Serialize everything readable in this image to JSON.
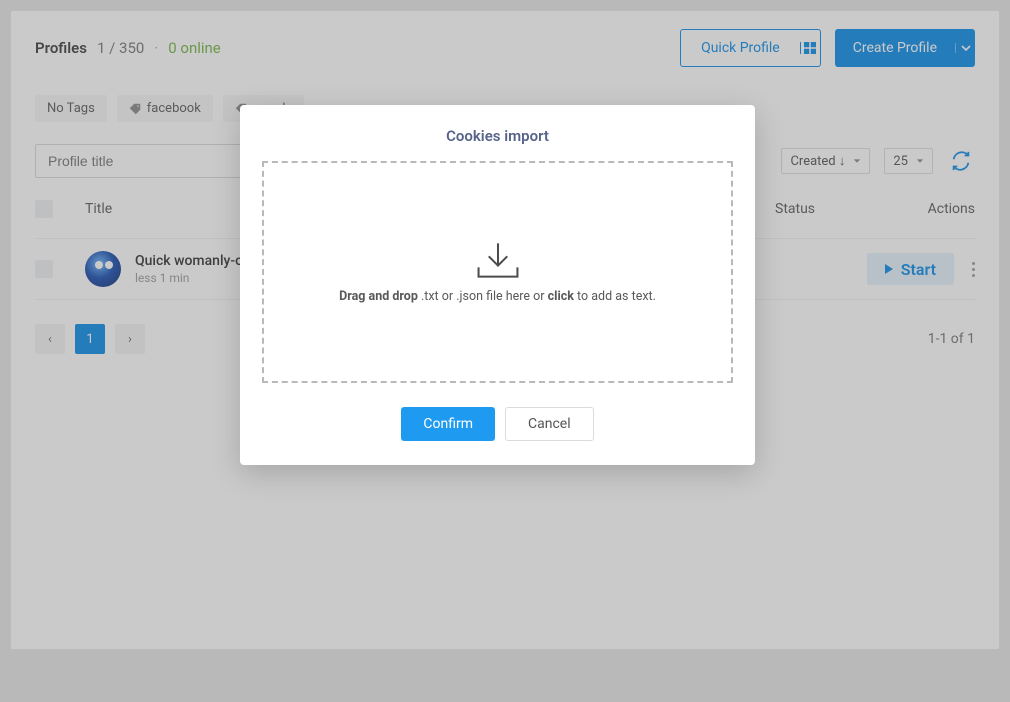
{
  "header": {
    "title": "Profiles",
    "count_text": "1 / 350",
    "online_text": "0 online",
    "quick_profile_label": "Quick Profile",
    "create_profile_label": "Create Profile"
  },
  "tags": {
    "items": [
      {
        "label": "No Tags",
        "has_icon": false
      },
      {
        "label": "facebook",
        "has_icon": true
      },
      {
        "label": "google",
        "has_icon": true
      }
    ]
  },
  "filters": {
    "title_placeholder": "Profile title",
    "sort_label": "Created ↓",
    "page_size": "25"
  },
  "columns": {
    "title": "Title",
    "status": "Status",
    "actions": "Actions"
  },
  "rows": [
    {
      "title": "Quick womanly-olive-dolphin",
      "subtitle": "less 1 min",
      "start_label": "Start"
    }
  ],
  "pagination": {
    "current": "1",
    "range_text": "1-1 of 1"
  },
  "modal": {
    "title": "Cookies import",
    "drop_prefix_bold": "Drag and drop",
    "drop_mid": " .txt or .json file here or ",
    "drop_click_bold": "click",
    "drop_suffix": " to add as text.",
    "confirm_label": "Confirm",
    "cancel_label": "Cancel"
  }
}
